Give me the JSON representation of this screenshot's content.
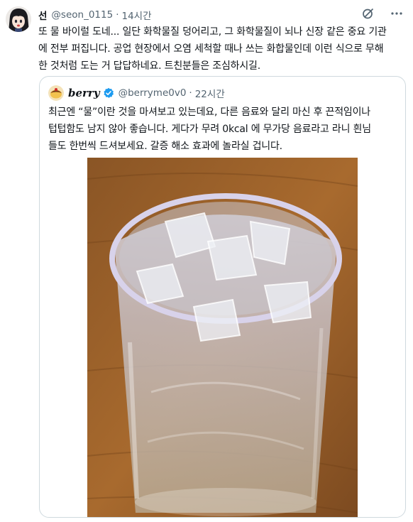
{
  "tweet": {
    "author_name": "선",
    "author_handle": "@seon_0115",
    "separator": "·",
    "time": "14시간",
    "text": "또 물 바이럴 도네... 일단 화학물질 덩어리고, 그 화학물질이 뇌나 신장 같은 중요 기관\n에 전부 퍼집니다. 공업 현장에서 오염 세척할 때나 쓰는 화합물인데 이런 식으로 무해\n한 것처럼 도는 거 답답하네요. 트친분들은 조심하시길."
  },
  "header_icons": [
    "grok-icon",
    "more-options-icon"
  ],
  "quoted_tweet": {
    "author_name": "berry",
    "author_handle": "@berryme0v0",
    "separator": "·",
    "time": "22시간",
    "verified": true,
    "text": "최근엔 “물”이란 것을 마셔보고 있는데요, 다른 음료와 달리 마신 후 끈적임이나\n텁텁함도 남지 않아 좋습니다. 게다가 무려 0kcal 에 무가당 음료라고 라니 흰님\n들도 한번씩 드셔보세요. 갈증 해소 효과에 놀라실 겁니다.",
    "media": "photo of a plastic cup of ice water on a wooden table"
  },
  "colors": {
    "text": "#0f1419",
    "secondary": "#536471",
    "border": "#cfd9de",
    "verified": "#1d9bf0"
  }
}
